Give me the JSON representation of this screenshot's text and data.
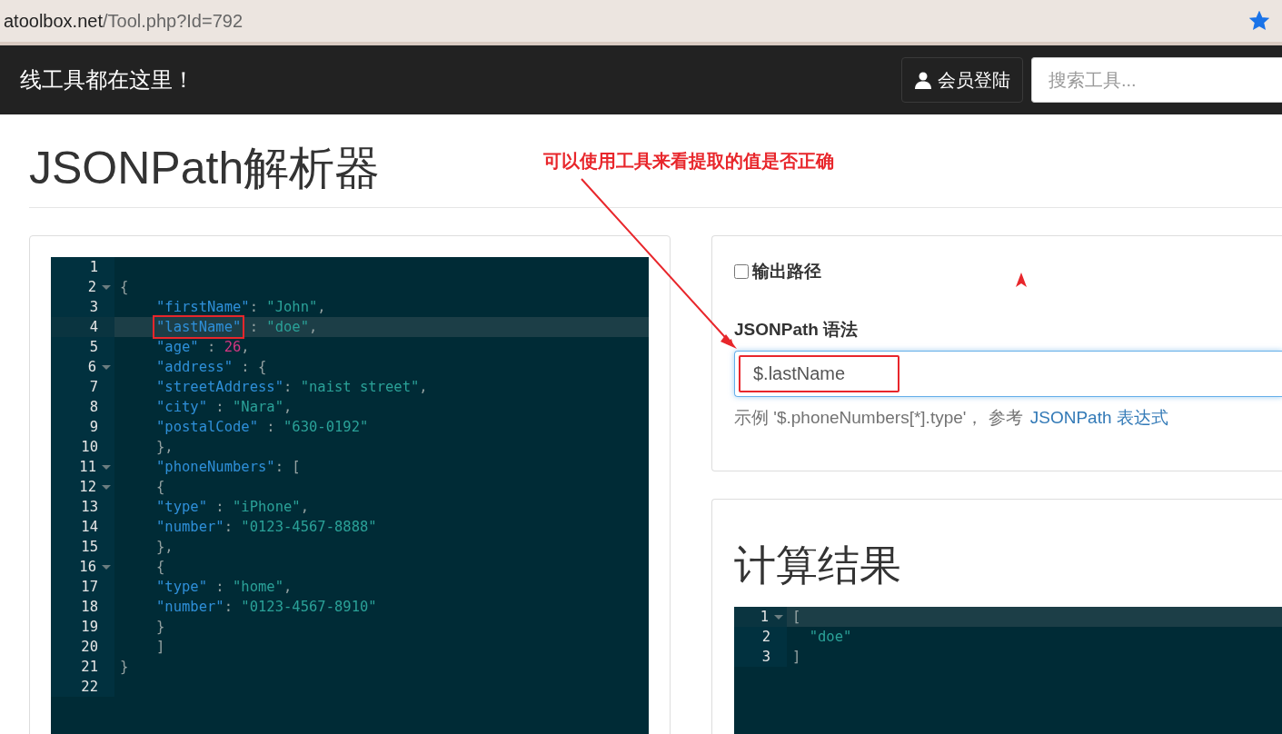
{
  "browser": {
    "url_host": "atoolbox.net",
    "url_path": "/Tool.php?Id=792",
    "bookmarked": true
  },
  "navbar": {
    "brand": "线工具都在这里！",
    "login_button": "会员登陆",
    "search": {
      "placeholder": "搜索工具..."
    }
  },
  "page_title": "JSONPath解析器",
  "annotation": {
    "text": "可以使用工具来看提取的值是否正确"
  },
  "source_editor": {
    "lines": [
      {
        "number": "1",
        "fold": false,
        "active": false
      },
      {
        "number": "2",
        "fold": true,
        "active": false,
        "indented": false,
        "tokens": [
          {
            "kind": "punct",
            "text": "{"
          }
        ]
      },
      {
        "number": "3",
        "fold": false,
        "active": false,
        "indented": true,
        "tokens": [
          {
            "kind": "key",
            "text": "\"firstName\""
          },
          {
            "kind": "punct",
            "text": ": "
          },
          {
            "kind": "string",
            "text": "\"John\""
          },
          {
            "kind": "punct",
            "text": ","
          }
        ]
      },
      {
        "number": "4",
        "fold": false,
        "active": true,
        "indented": true,
        "tokens": [
          {
            "kind": "key",
            "text": "\"lastName\"",
            "boxed": true
          },
          {
            "kind": "punct",
            "text": " : "
          },
          {
            "kind": "string",
            "text": "\"doe\""
          },
          {
            "kind": "punct",
            "text": ","
          }
        ]
      },
      {
        "number": "5",
        "fold": false,
        "active": false,
        "indented": true,
        "tokens": [
          {
            "kind": "key",
            "text": "\"age\""
          },
          {
            "kind": "punct",
            "text": " : "
          },
          {
            "kind": "number",
            "text": "26"
          },
          {
            "kind": "punct",
            "text": ","
          }
        ]
      },
      {
        "number": "6",
        "fold": true,
        "active": false,
        "indented": true,
        "tokens": [
          {
            "kind": "key",
            "text": "\"address\""
          },
          {
            "kind": "punct",
            "text": " : {"
          }
        ]
      },
      {
        "number": "7",
        "fold": false,
        "active": false,
        "indented": true,
        "tokens": [
          {
            "kind": "key",
            "text": "\"streetAddress\""
          },
          {
            "kind": "punct",
            "text": ": "
          },
          {
            "kind": "string",
            "text": "\"naist street\""
          },
          {
            "kind": "punct",
            "text": ","
          }
        ]
      },
      {
        "number": "8",
        "fold": false,
        "active": false,
        "indented": true,
        "tokens": [
          {
            "kind": "key",
            "text": "\"city\""
          },
          {
            "kind": "punct",
            "text": " : "
          },
          {
            "kind": "string",
            "text": "\"Nara\""
          },
          {
            "kind": "punct",
            "text": ","
          }
        ]
      },
      {
        "number": "9",
        "fold": false,
        "active": false,
        "indented": true,
        "tokens": [
          {
            "kind": "key",
            "text": "\"postalCode\""
          },
          {
            "kind": "punct",
            "text": " : "
          },
          {
            "kind": "string",
            "text": "\"630-0192\""
          }
        ]
      },
      {
        "number": "10",
        "fold": false,
        "active": false,
        "indented": true,
        "tokens": [
          {
            "kind": "punct",
            "text": "},"
          }
        ]
      },
      {
        "number": "11",
        "fold": true,
        "active": false,
        "indented": true,
        "tokens": [
          {
            "kind": "key",
            "text": "\"phoneNumbers\""
          },
          {
            "kind": "punct",
            "text": ": ["
          }
        ]
      },
      {
        "number": "12",
        "fold": true,
        "active": false,
        "indented": true,
        "tokens": [
          {
            "kind": "punct",
            "text": "{"
          }
        ]
      },
      {
        "number": "13",
        "fold": false,
        "active": false,
        "indented": true,
        "tokens": [
          {
            "kind": "key",
            "text": "\"type\""
          },
          {
            "kind": "punct",
            "text": " : "
          },
          {
            "kind": "string",
            "text": "\"iPhone\""
          },
          {
            "kind": "punct",
            "text": ","
          }
        ]
      },
      {
        "number": "14",
        "fold": false,
        "active": false,
        "indented": true,
        "tokens": [
          {
            "kind": "key",
            "text": "\"number\""
          },
          {
            "kind": "punct",
            "text": ": "
          },
          {
            "kind": "string",
            "text": "\"0123-4567-8888\""
          }
        ]
      },
      {
        "number": "15",
        "fold": false,
        "active": false,
        "indented": true,
        "tokens": [
          {
            "kind": "punct",
            "text": "},"
          }
        ]
      },
      {
        "number": "16",
        "fold": true,
        "active": false,
        "indented": true,
        "tokens": [
          {
            "kind": "punct",
            "text": "{"
          }
        ]
      },
      {
        "number": "17",
        "fold": false,
        "active": false,
        "indented": true,
        "tokens": [
          {
            "kind": "key",
            "text": "\"type\""
          },
          {
            "kind": "punct",
            "text": " : "
          },
          {
            "kind": "string",
            "text": "\"home\""
          },
          {
            "kind": "punct",
            "text": ","
          }
        ]
      },
      {
        "number": "18",
        "fold": false,
        "active": false,
        "indented": true,
        "tokens": [
          {
            "kind": "key",
            "text": "\"number\""
          },
          {
            "kind": "punct",
            "text": ": "
          },
          {
            "kind": "string",
            "text": "\"0123-4567-8910\""
          }
        ]
      },
      {
        "number": "19",
        "fold": false,
        "active": false,
        "indented": true,
        "tokens": [
          {
            "kind": "punct",
            "text": "}"
          }
        ]
      },
      {
        "number": "20",
        "fold": false,
        "active": false,
        "indented": true,
        "tokens": [
          {
            "kind": "punct",
            "text": "]"
          }
        ]
      },
      {
        "number": "21",
        "fold": false,
        "active": false,
        "indented": false,
        "tokens": [
          {
            "kind": "punct",
            "text": "}"
          }
        ]
      },
      {
        "number": "22",
        "fold": false,
        "active": false
      }
    ]
  },
  "options": {
    "output_path": {
      "label": "输出路径",
      "checked": false
    },
    "syntax_label": "JSONPath 语法",
    "expression": {
      "value": "$.lastName",
      "boxed": true
    },
    "hint": "示例 '$.phoneNumbers[*].type'， 参考",
    "hint_link": "JSONPath 表达式"
  },
  "result": {
    "title": "计算结果",
    "lines": [
      {
        "number": "1",
        "fold": true,
        "active": true,
        "indented": false,
        "tokens": [
          {
            "kind": "punct",
            "text": "["
          }
        ]
      },
      {
        "number": "2",
        "fold": false,
        "active": false,
        "indented": false,
        "tokens": [
          {
            "kind": "string",
            "text": "  \"doe\""
          }
        ]
      },
      {
        "number": "3",
        "fold": false,
        "active": false,
        "indented": false,
        "tokens": [
          {
            "kind": "punct",
            "text": "]"
          }
        ]
      }
    ]
  }
}
